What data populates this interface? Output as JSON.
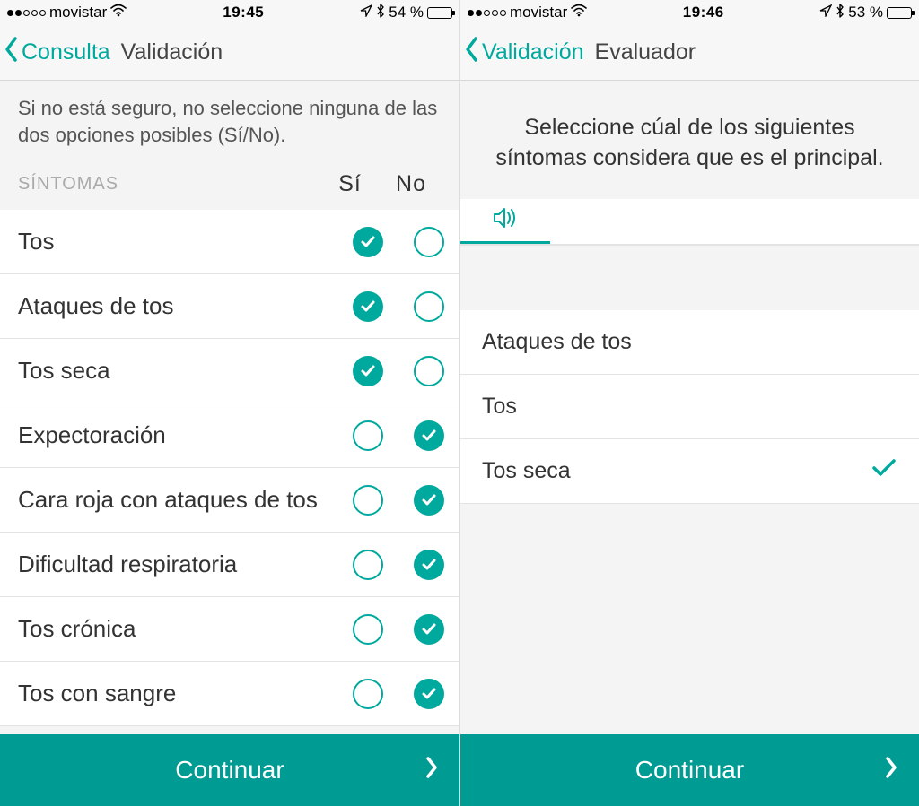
{
  "accent": "#00a99d",
  "screens": {
    "left": {
      "status": {
        "carrier": "movistar",
        "time": "19:45",
        "battery": "54 %",
        "battery_fill": 54
      },
      "nav": {
        "back": "Consulta",
        "title": "Validación"
      },
      "instruction": "Si no está seguro, no seleccione ninguna de las dos opciones posibles (Sí/No).",
      "header": {
        "label": "SÍNTOMAS",
        "yes": "Sí",
        "no": "No"
      },
      "symptoms": [
        {
          "label": "Tos",
          "si": true,
          "no": false
        },
        {
          "label": "Ataques de tos",
          "si": true,
          "no": false
        },
        {
          "label": "Tos seca",
          "si": true,
          "no": false
        },
        {
          "label": "Expectoración",
          "si": false,
          "no": true
        },
        {
          "label": "Cara roja con ataques de tos",
          "si": false,
          "no": true
        },
        {
          "label": "Dificultad respiratoria",
          "si": false,
          "no": true
        },
        {
          "label": "Tos crónica",
          "si": false,
          "no": true
        },
        {
          "label": "Tos con sangre",
          "si": false,
          "no": true
        }
      ],
      "continue": "Continuar"
    },
    "right": {
      "status": {
        "carrier": "movistar",
        "time": "19:46",
        "battery": "53 %",
        "battery_fill": 53
      },
      "nav": {
        "back": "Validación",
        "title": "Evaluador"
      },
      "prompt": "Seleccione cúal de los siguientes síntomas considera que es el principal.",
      "tab_icon": "speaker-icon",
      "options": [
        {
          "label": "Ataques de tos",
          "selected": false
        },
        {
          "label": "Tos",
          "selected": false
        },
        {
          "label": "Tos seca",
          "selected": true
        }
      ],
      "continue": "Continuar"
    }
  }
}
